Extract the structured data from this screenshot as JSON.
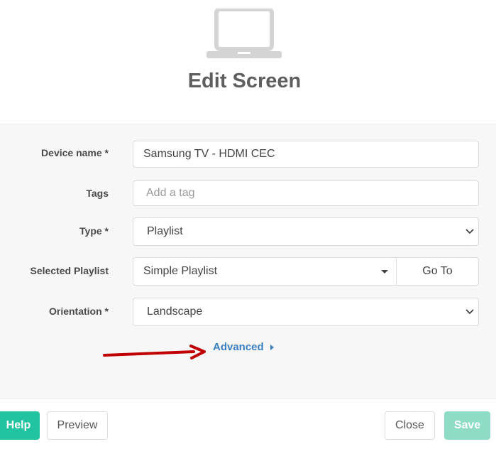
{
  "dialog": {
    "title": "Edit Screen",
    "icon": "laptop-icon"
  },
  "form": {
    "device_name": {
      "label": "Device name *",
      "value": "Samsung TV - HDMI CEC"
    },
    "tags": {
      "label": "Tags",
      "placeholder": "Add a tag"
    },
    "type": {
      "label": "Type *",
      "value": "Playlist"
    },
    "selected_playlist": {
      "label": "Selected Playlist",
      "value": "Simple Playlist",
      "goto_label": "Go To"
    },
    "orientation": {
      "label": "Orientation *",
      "value": "Landscape"
    },
    "advanced_label": "Advanced"
  },
  "footer": {
    "help_label": "Help",
    "preview_label": "Preview",
    "close_label": "Close",
    "save_label": "Save"
  },
  "colors": {
    "accent": "#22c3a0",
    "save_disabled": "#8fdcc6",
    "link": "#3a7fc0",
    "annotation_arrow": "#c00000"
  }
}
